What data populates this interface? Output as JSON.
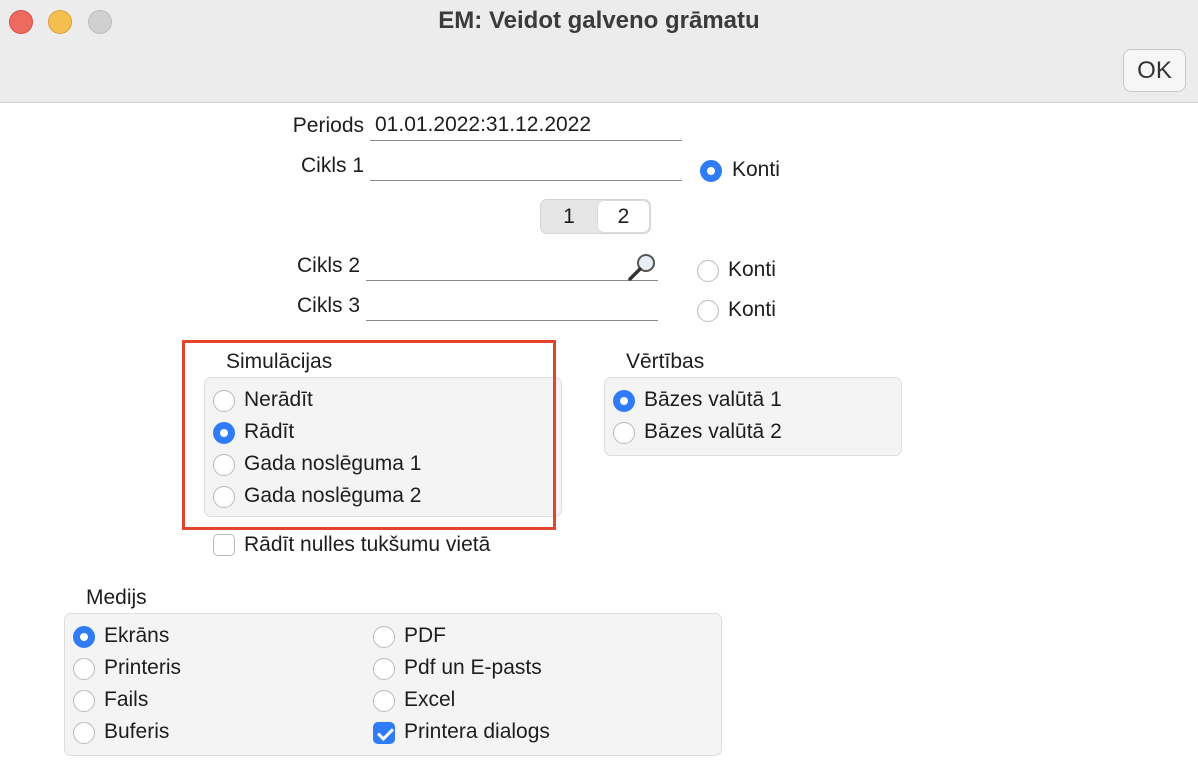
{
  "window": {
    "title": "EM: Veidot galveno grāmatu",
    "ok_label": "OK"
  },
  "periods": {
    "label": "Periods",
    "value": "01.01.2022:31.12.2022"
  },
  "cikls1": {
    "label": "Cikls 1",
    "value": "",
    "konti_label": "Konti",
    "konti_selected": true
  },
  "tabs": {
    "items": [
      "1",
      "2"
    ],
    "selected": "2"
  },
  "cikls2": {
    "label": "Cikls 2",
    "value": "",
    "konti_label": "Konti",
    "konti_selected": false
  },
  "cikls3": {
    "label": "Cikls 3",
    "value": "",
    "konti_label": "Konti",
    "konti_selected": false
  },
  "simulacijas": {
    "title": "Simulācijas",
    "options": [
      "Nerādīt",
      "Rādīt",
      "Gada noslēguma 1",
      "Gada noslēguma 2"
    ],
    "selected": "Rādīt"
  },
  "vertibas": {
    "title": "Vērtības",
    "options": [
      "Bāzes valūtā 1",
      "Bāzes valūtā 2"
    ],
    "selected": "Bāzes valūtā 1"
  },
  "radit_nulles": {
    "label": "Rādīt nulles tukšumu vietā",
    "checked": false
  },
  "medijs": {
    "title": "Medijs",
    "options": [
      "Ekrāns",
      "Printeris",
      "Fails",
      "Buferis",
      "PDF",
      "Pdf un E-pasts",
      "Excel"
    ],
    "selected": "Ekrāns",
    "printera_dialogs": {
      "label": "Printera dialogs",
      "checked": true
    }
  },
  "colors": {
    "accent": "#2f7cf6",
    "highlight_border": "#e2442c"
  }
}
